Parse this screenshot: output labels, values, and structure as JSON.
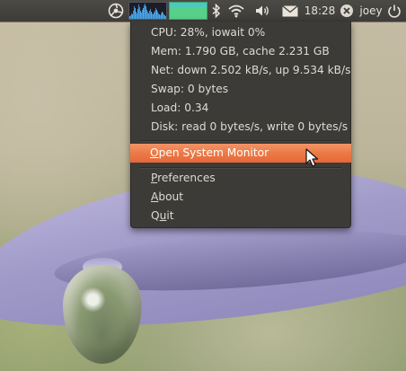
{
  "panel": {
    "clock": "18:28",
    "user": "joey",
    "icons": [
      "ubuntu-logo-icon",
      "cpu-graph",
      "memory-graph",
      "bluetooth-icon",
      "wifi-icon",
      "volume-icon",
      "mail-icon",
      "user-status-icon",
      "power-icon"
    ]
  },
  "menu": {
    "cpu": "CPU: 28%, iowait 0%",
    "mem": "Mem: 1.790 GB, cache 2.231 GB",
    "net": "Net: down 2.502 kB/s, up 9.534 kB/s",
    "swap": "Swap: 0 bytes",
    "load": "Load: 0.34",
    "disk": "Disk: read 0 bytes/s, write 0 bytes/s",
    "open_monitor": "Open System Monitor",
    "preferences": "Preferences",
    "about": "About",
    "quit": "Quit"
  },
  "colors": {
    "panel": "#3d3c38",
    "menu_bg": "#3c3b37",
    "highlight": "#ec7a45",
    "memory_graph": "#57d089",
    "cpu_graph": "#3a8fd0"
  }
}
